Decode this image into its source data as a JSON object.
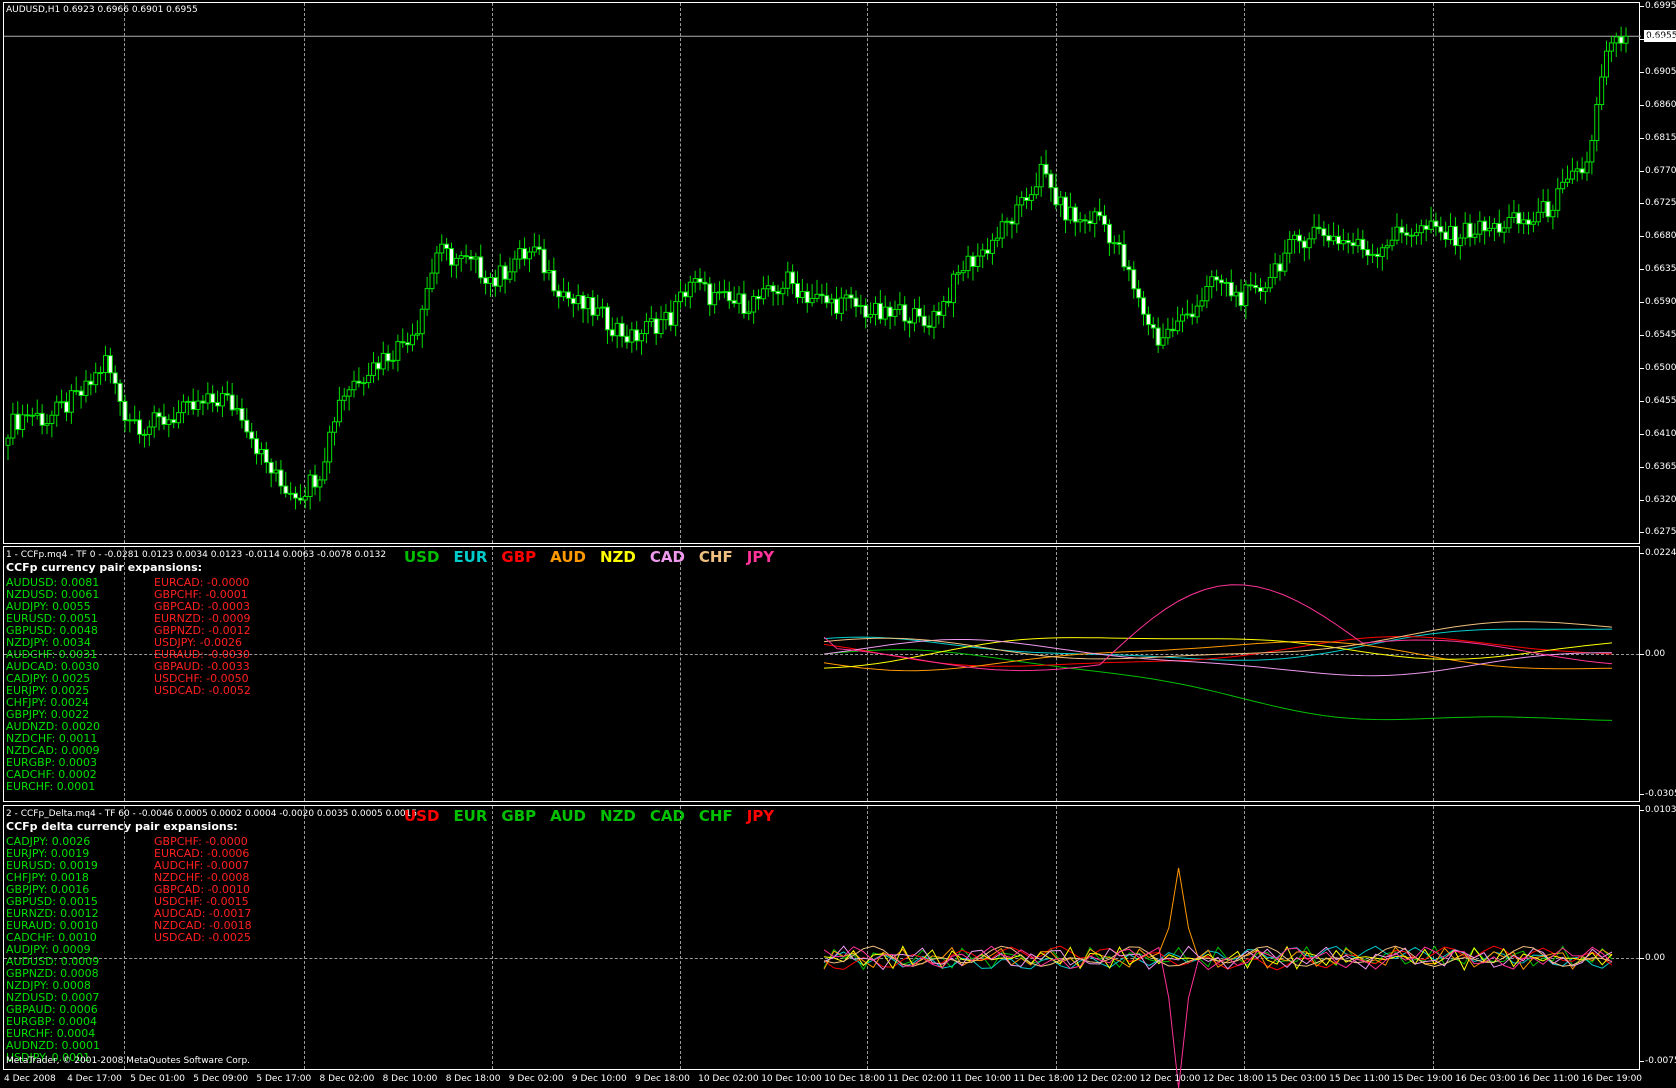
{
  "main": {
    "header": "AUDUSD,H1  0.6923 0.6966 0.6901 0.6955",
    "current_price": "0.6955",
    "price_axis": [
      "0.6995",
      "0.6950",
      "0.6905",
      "0.6860",
      "0.6815",
      "0.6770",
      "0.6725",
      "0.6680",
      "0.6635",
      "0.6590",
      "0.6545",
      "0.6500",
      "0.6455",
      "0.6410",
      "0.6365",
      "0.6320",
      "0.6275"
    ]
  },
  "ccfp": {
    "header": "1 - CCFp.mq4  - TF 0 -  -0.0281 0.0123 0.0034 0.0123 -0.0114 0.0063 -0.0078 0.0132",
    "title": "CCFp currency pair expansions:",
    "currencies": [
      {
        "name": "USD",
        "color": "#00c000"
      },
      {
        "name": "EUR",
        "color": "#00cccc"
      },
      {
        "name": "GBP",
        "color": "#ff0000"
      },
      {
        "name": "AUD",
        "color": "#ff9900"
      },
      {
        "name": "NZD",
        "color": "#ffff00"
      },
      {
        "name": "CAD",
        "color": "#ee99ee"
      },
      {
        "name": "CHF",
        "color": "#f0c080"
      },
      {
        "name": "JPY",
        "color": "#ff3399"
      }
    ],
    "positive": [
      "AUDUSD: 0.0081",
      "NZDUSD: 0.0061",
      "AUDJPY: 0.0055",
      "EURUSD: 0.0051",
      "GBPUSD: 0.0048",
      "NZDJPY: 0.0034",
      "AUDCHF: 0.0031",
      "AUDCAD: 0.0030",
      "CADJPY: 0.0025",
      "EURJPY: 0.0025",
      "CHFJPY: 0.0024",
      "GBPJPY: 0.0022",
      "AUDNZD: 0.0020",
      "NZDCHF: 0.0011",
      "NZDCAD: 0.0009",
      "EURGBP: 0.0003",
      "CADCHF: 0.0002",
      "EURCHF: 0.0001"
    ],
    "negative": [
      "EURCAD: -0.0000",
      "GBPCHF: -0.0001",
      "GBPCAD: -0.0003",
      "EURNZD: -0.0009",
      "GBPNZD: -0.0012",
      "USDJPY: -0.0026",
      "EURAUD: -0.0030",
      "GBPAUD: -0.0033",
      "USDCHF: -0.0050",
      "USDCAD: -0.0052"
    ],
    "axis": {
      "top": "0.0224",
      "zero": "0.00",
      "bottom": "-0.0305"
    }
  },
  "delta": {
    "header": "2 - CCFp_Delta.mq4  - TF 60 -  -0.0046 0.0005 0.0002 0.0004 -0.0020 0.0035 0.0005 0.0015",
    "title": "CCFp delta currency pair expansions:",
    "currencies": [
      {
        "name": "USD",
        "color": "#ff0000"
      },
      {
        "name": "EUR",
        "color": "#00c000"
      },
      {
        "name": "GBP",
        "color": "#00c000"
      },
      {
        "name": "AUD",
        "color": "#00c000"
      },
      {
        "name": "NZD",
        "color": "#00c000"
      },
      {
        "name": "CAD",
        "color": "#00c000"
      },
      {
        "name": "CHF",
        "color": "#00c000"
      },
      {
        "name": "JPY",
        "color": "#ff0000"
      }
    ],
    "positive": [
      "CADJPY: 0.0026",
      "EURJPY: 0.0019",
      "EURUSD: 0.0019",
      "CHFJPY: 0.0018",
      "GBPJPY: 0.0016",
      "GBPUSD: 0.0015",
      "EURNZD: 0.0012",
      "EURAUD: 0.0010",
      "CADCHF: 0.0010",
      "AUDJPY: 0.0009",
      "AUDUSD: 0.0009",
      "GBPNZD: 0.0008",
      "NZDJPY: 0.0008",
      "NZDUSD: 0.0007",
      "GBPAUD: 0.0006",
      "EURGBP: 0.0004",
      "EURCHF: 0.0004",
      "AUDNZD: 0.0001",
      "USDJPY: 0.0001"
    ],
    "negative": [
      "GBPCHF: -0.0000",
      "EURCAD: -0.0006",
      "AUDCHF: -0.0007",
      "NZDCHF: -0.0008",
      "GBPCAD: -0.0010",
      "USDCHF: -0.0015",
      "AUDCAD: -0.0017",
      "NZDCAD: -0.0018",
      "USDCAD: -0.0025"
    ],
    "axis": {
      "top": "0.0103",
      "zero": "0.00",
      "bottom": "-0.0075"
    },
    "copyright": "MetaTrader, © 2001-2008 MetaQuotes Software Corp."
  },
  "time_axis": [
    "4 Dec 2008",
    "4 Dec 17:00",
    "5 Dec 01:00",
    "5 Dec 09:00",
    "5 Dec 17:00",
    "8 Dec 02:00",
    "8 Dec 10:00",
    "8 Dec 18:00",
    "9 Dec 02:00",
    "9 Dec 10:00",
    "9 Dec 18:00",
    "10 Dec 02:00",
    "10 Dec 10:00",
    "10 Dec 18:00",
    "11 Dec 02:00",
    "11 Dec 10:00",
    "11 Dec 18:00",
    "12 Dec 02:00",
    "12 Dec 10:00",
    "12 Dec 18:00",
    "15 Dec 03:00",
    "15 Dec 11:00",
    "15 Dec 19:00",
    "16 Dec 03:00",
    "16 Dec 11:00",
    "16 Dec 19:00"
  ],
  "chart_data": {
    "type": "candlestick",
    "symbol": "AUDUSD",
    "timeframe": "H1",
    "ylim": [
      0.6275,
      0.6995
    ],
    "approx_close_path": [
      0.642,
      0.644,
      0.643,
      0.645,
      0.647,
      0.651,
      0.644,
      0.642,
      0.643,
      0.644,
      0.645,
      0.646,
      0.644,
      0.638,
      0.634,
      0.633,
      0.636,
      0.646,
      0.649,
      0.651,
      0.653,
      0.656,
      0.666,
      0.665,
      0.664,
      0.662,
      0.665,
      0.666,
      0.662,
      0.659,
      0.658,
      0.656,
      0.654,
      0.656,
      0.657,
      0.662,
      0.66,
      0.659,
      0.659,
      0.66,
      0.662,
      0.66,
      0.659,
      0.659,
      0.658,
      0.657,
      0.658,
      0.656,
      0.659,
      0.664,
      0.666,
      0.669,
      0.672,
      0.677,
      0.672,
      0.67,
      0.671,
      0.666,
      0.659,
      0.654,
      0.656,
      0.659,
      0.662,
      0.66,
      0.66,
      0.664,
      0.667,
      0.669,
      0.668,
      0.667,
      0.666,
      0.668,
      0.669,
      0.669,
      0.668,
      0.669,
      0.669,
      0.67,
      0.67,
      0.672,
      0.675,
      0.678,
      0.693,
      0.6955
    ]
  }
}
